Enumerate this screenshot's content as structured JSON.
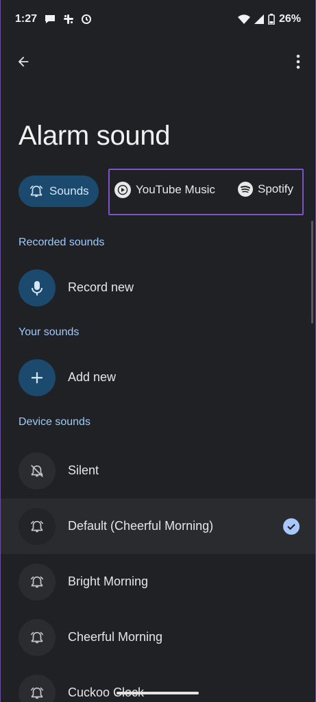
{
  "status_bar": {
    "time": "1:27",
    "battery": "26%"
  },
  "header": {
    "title": "Alarm sound"
  },
  "chips": {
    "sounds": "Sounds",
    "youtube_music": "YouTube Music",
    "spotify": "Spotify"
  },
  "sections": {
    "recorded": {
      "label": "Recorded sounds",
      "items": [
        {
          "label": "Record new",
          "icon": "mic-icon"
        }
      ]
    },
    "yours": {
      "label": "Your sounds",
      "items": [
        {
          "label": "Add new",
          "icon": "plus-icon"
        }
      ]
    },
    "device": {
      "label": "Device sounds",
      "items": [
        {
          "label": "Silent",
          "icon": "alarm-off-icon",
          "selected": false
        },
        {
          "label": "Default (Cheerful Morning)",
          "icon": "alarm-icon",
          "selected": true
        },
        {
          "label": "Bright Morning",
          "icon": "alarm-icon",
          "selected": false
        },
        {
          "label": "Cheerful Morning",
          "icon": "alarm-icon",
          "selected": false
        },
        {
          "label": "Cuckoo Clock",
          "icon": "alarm-icon",
          "selected": false
        }
      ]
    }
  },
  "colors": {
    "background": "#202124",
    "accent": "#9ecaff",
    "chip_selected": "#1b4a6e",
    "highlight_box": "#7c53c9",
    "check": "#a8c7fa"
  }
}
